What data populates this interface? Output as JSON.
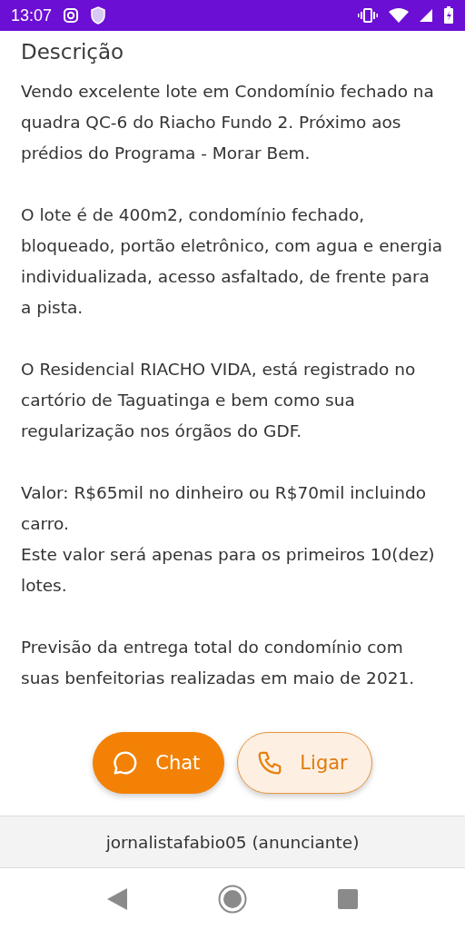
{
  "status_bar": {
    "time": "13:07"
  },
  "description": {
    "title": "Descrição",
    "groups": [
      [
        "Vendo excelente lote em Condomínio fechado na quadra QC-6 do Riacho Fundo 2. Próximo aos prédios do Programa - Morar Bem."
      ],
      [
        "O lote é de 400m2, condomínio fechado, bloqueado, portão eletrônico, com agua e energia individualizada, acesso asfaltado, de frente para a pista."
      ],
      [
        "O Residencial RIACHO VIDA, está registrado no cartório de Taguatinga e bem como sua regularização nos órgãos do GDF."
      ],
      [
        "Valor: R$65mil no dinheiro ou R$70mil incluindo carro.",
        "Este valor será apenas para os primeiros 10(dez) lotes."
      ],
      [
        "Previsão da entrega total do condomínio com suas benfeitorias realizadas em maio de 2021."
      ]
    ]
  },
  "actions": [
    {
      "kind": "chat",
      "label": "Chat"
    },
    {
      "kind": "call",
      "label": "Ligar"
    }
  ],
  "advertiser": "jornalistafabio05 (anunciante)"
}
